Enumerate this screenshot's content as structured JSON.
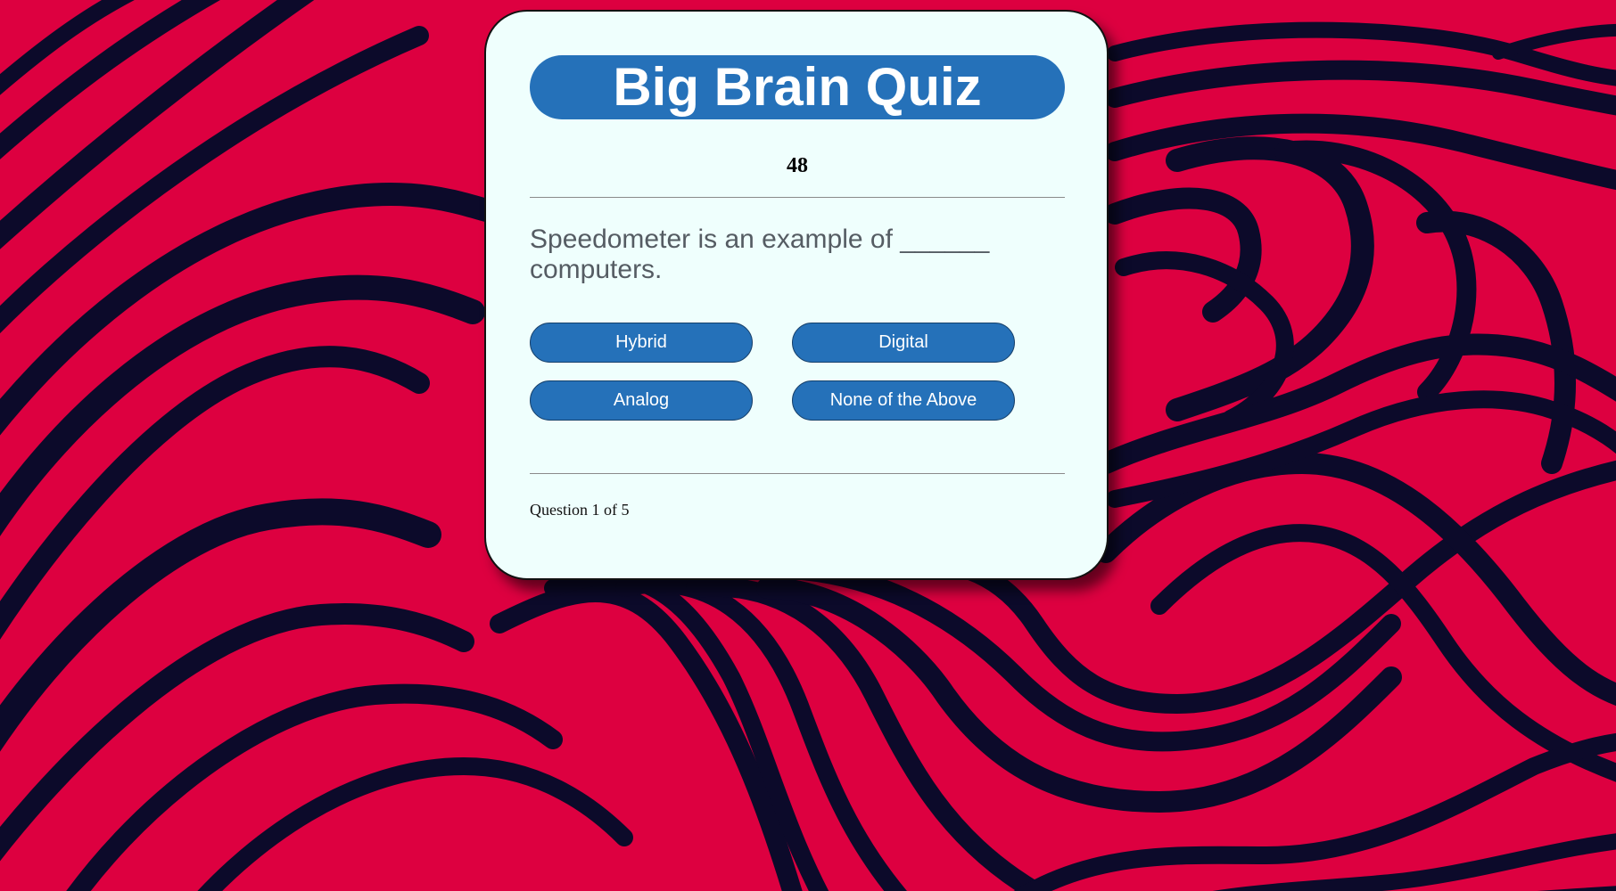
{
  "quiz": {
    "title": "Big Brain Quiz",
    "timer": "48",
    "question": "Speedometer is an example of ______ computers.",
    "answers": [
      "Hybrid",
      "Digital",
      "Analog",
      "None of the Above"
    ],
    "progress_text": "Question 1 of 5"
  },
  "colors": {
    "background": "#dd0040",
    "stripes": "#0c0a2a",
    "card": "#effffd",
    "accent": "#2571b9"
  }
}
